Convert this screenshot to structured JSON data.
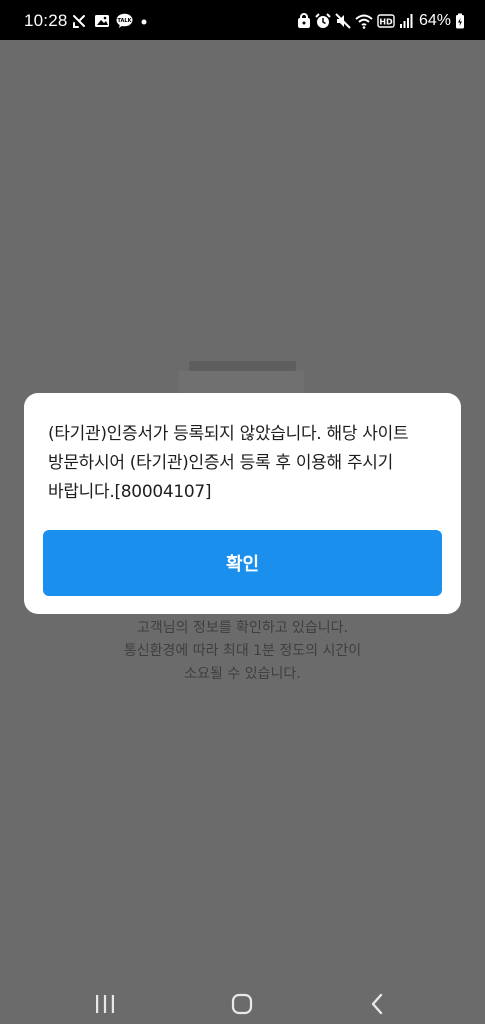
{
  "status_bar": {
    "time": "10:28",
    "battery": "64%",
    "left_icons": [
      "missed-call-icon",
      "gallery-icon",
      "talk-icon",
      "dot-icon"
    ],
    "right_icons": [
      "lock-icon",
      "alarm-icon",
      "mute-icon",
      "wifi-icon",
      "hd-icon",
      "signal-icon",
      "battery-icon"
    ],
    "hd_label": "HD",
    "talk_label": "TALK"
  },
  "dialog": {
    "message_lines": [
      "(타기관)인증서가 등록되지 않았습니다. 해당 사이트",
      "방문하시어 (타기관)인증서 등록 후 이용해 주시기",
      "바랍니다.[80004107]"
    ],
    "confirm_label": "확인",
    "button_color": "#1b8fee"
  },
  "loading": {
    "lines": [
      "고객님의 정보를 확인하고 있습니다.",
      "통신환경에 따라 최대 1분 정도의 시간이",
      "소요될 수 있습니다."
    ]
  },
  "nav": {
    "icons": [
      "recent-apps-icon",
      "home-icon",
      "back-icon"
    ]
  }
}
